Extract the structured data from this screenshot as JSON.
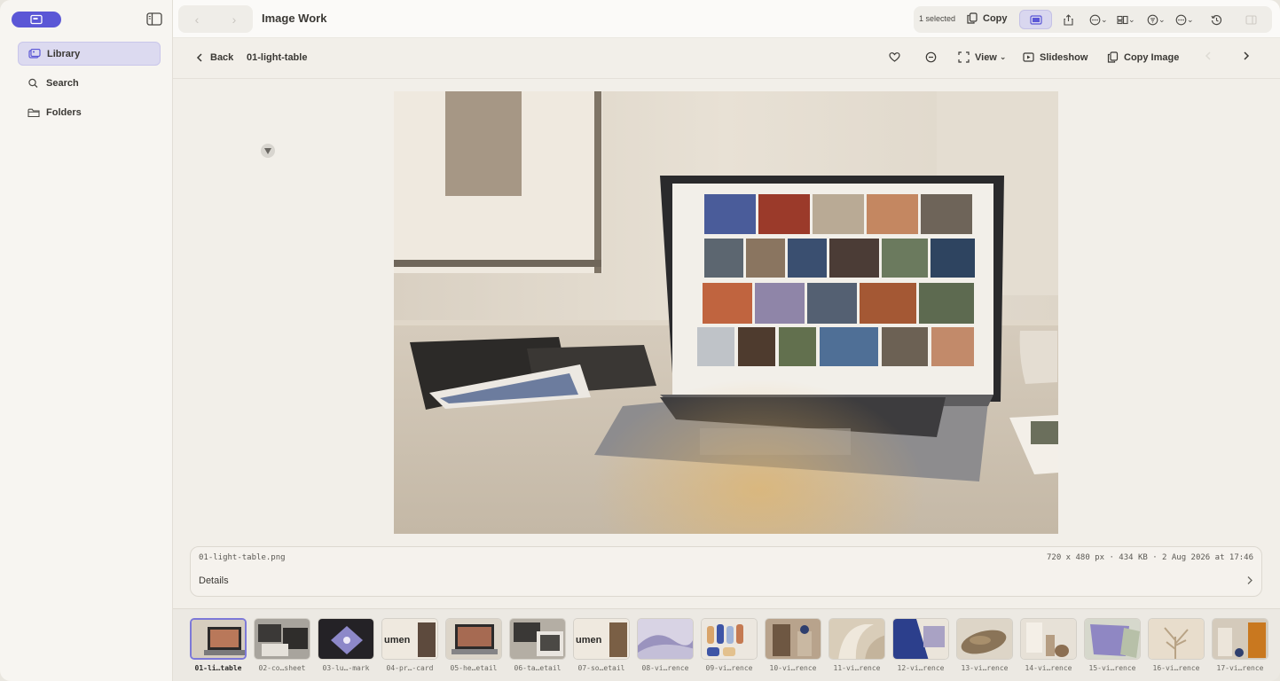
{
  "window": {
    "title": "Image Work"
  },
  "sidebar": {
    "items": [
      {
        "label": "Library",
        "icon": "library-icon",
        "active": true
      },
      {
        "label": "Search",
        "icon": "search-icon",
        "active": false
      },
      {
        "label": "Folders",
        "icon": "folder-icon",
        "active": false
      }
    ]
  },
  "toolbar": {
    "selection_count": "1 selected",
    "copy_label": "Copy"
  },
  "viewer": {
    "back_label": "Back",
    "title": "01-light-table",
    "view_label": "View",
    "slideshow_label": "Slideshow",
    "copy_image_label": "Copy Image"
  },
  "info": {
    "filename": "01-light-table.png",
    "meta": "720 x 480 px · 434 KB · 2 Aug 2026 at 17:46",
    "details_label": "Details"
  },
  "filmstrip": [
    {
      "label": "01-li…table",
      "active": true
    },
    {
      "label": "02-co…sheet"
    },
    {
      "label": "03-lu…-mark"
    },
    {
      "label": "04-pr…-card"
    },
    {
      "label": "05-he…etail"
    },
    {
      "label": "06-ta…etail"
    },
    {
      "label": "07-so…etail"
    },
    {
      "label": "08-vi…rence"
    },
    {
      "label": "09-vi…rence"
    },
    {
      "label": "10-vi…rence"
    },
    {
      "label": "11-vi…rence"
    },
    {
      "label": "12-vi…rence"
    },
    {
      "label": "13-vi…rence"
    },
    {
      "label": "14-vi…rence"
    },
    {
      "label": "15-vi…rence"
    },
    {
      "label": "16-vi…rence"
    },
    {
      "label": "17-vi…rence"
    }
  ],
  "colors": {
    "accent": "#5b57d6",
    "accent_soft": "#dcdaf0",
    "background": "#f2efe9"
  }
}
